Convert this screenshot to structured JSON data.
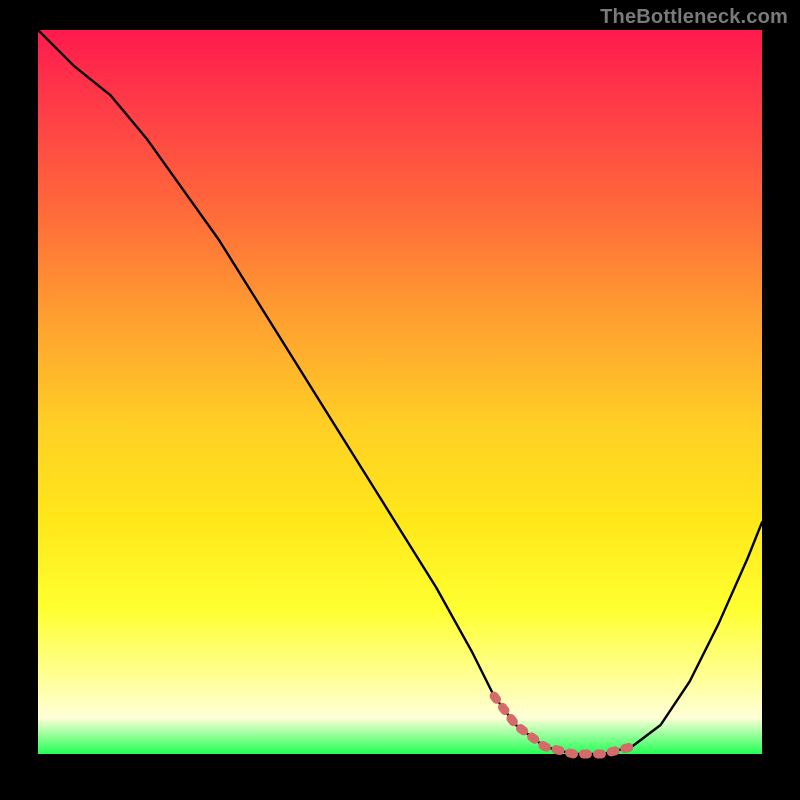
{
  "watermark": "TheBottleneck.com",
  "gradient_colors": {
    "top": "#ff1a4d",
    "mid_upper": "#ff6a3a",
    "mid": "#ffd024",
    "mid_lower": "#ffff30",
    "bottom": "#22ff55"
  },
  "chart_data": {
    "type": "line",
    "title": "",
    "xlabel": "",
    "ylabel": "",
    "xlim": [
      0,
      100
    ],
    "ylim": [
      0,
      100
    ],
    "series": [
      {
        "name": "bottleneck-curve",
        "x": [
          0,
          5,
          10,
          15,
          20,
          25,
          30,
          35,
          40,
          45,
          50,
          55,
          60,
          63,
          66,
          70,
          74,
          78,
          82,
          86,
          90,
          94,
          98,
          100
        ],
        "values": [
          100,
          95,
          91,
          85,
          78,
          71,
          63,
          55,
          47,
          39,
          31,
          23,
          14,
          8,
          4,
          1,
          0,
          0,
          1,
          4,
          10,
          18,
          27,
          32
        ]
      }
    ],
    "highlight_region": {
      "name": "valley-marker",
      "x": [
        63,
        66,
        70,
        74,
        78,
        82
      ],
      "values": [
        8,
        4,
        1,
        0,
        0,
        1
      ]
    }
  }
}
